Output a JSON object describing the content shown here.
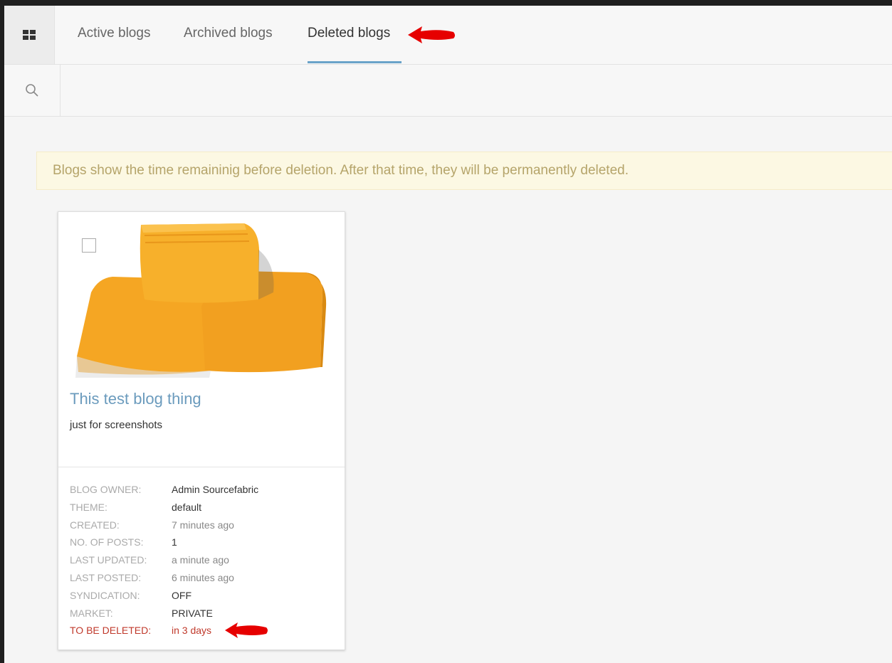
{
  "tabs": [
    {
      "label": "Active blogs"
    },
    {
      "label": "Archived blogs"
    },
    {
      "label": "Deleted blogs",
      "active": true
    }
  ],
  "search": {
    "placeholder": ""
  },
  "notice": "Blogs show the time remaininig before deletion. After that time, they will be permanently deleted.",
  "card": {
    "title": "This test blog thing",
    "description": "just for screenshots",
    "meta": [
      {
        "label": "BLOG OWNER:",
        "value": "Admin Sourcefabric"
      },
      {
        "label": "THEME:",
        "value": "default"
      },
      {
        "label": "CREATED:",
        "value": "7 minutes ago"
      },
      {
        "label": "NO. OF POSTS:",
        "value": "1"
      },
      {
        "label": "LAST UPDATED:",
        "value": "a minute ago"
      },
      {
        "label": "LAST POSTED:",
        "value": "6 minutes ago"
      },
      {
        "label": "SYNDICATION:",
        "value": "OFF"
      },
      {
        "label": "MARKET:",
        "value": "PRIVATE"
      },
      {
        "label": "TO BE DELETED:",
        "value": "in 3 days"
      }
    ]
  },
  "colors": {
    "accent": "#6aa3c9",
    "deleted": "#c0392b",
    "notice_bg": "#fcf8e3",
    "notice_text": "#b5a46a",
    "annotation_arrow": "#e60000"
  },
  "icons": [
    "grid-icon",
    "search-icon",
    "annotation-arrow-icon"
  ]
}
